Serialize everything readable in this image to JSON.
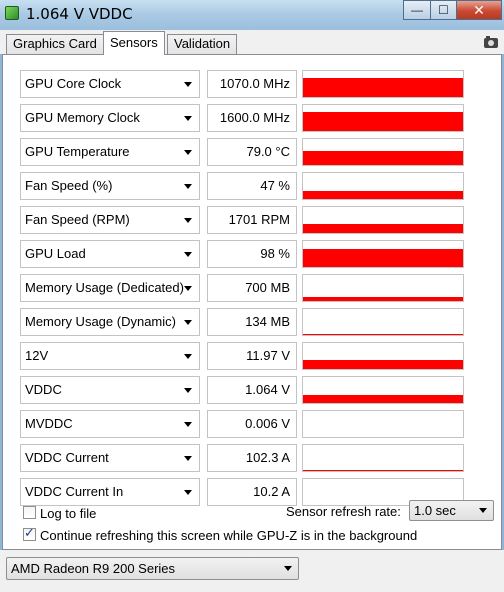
{
  "window": {
    "title": "1.064 V VDDC",
    "minimize_glyph": "—",
    "maximize_glyph": "☐",
    "close_glyph": "✕"
  },
  "tabs": [
    {
      "label": "Graphics Card"
    },
    {
      "label": "Sensors"
    },
    {
      "label": "Validation"
    }
  ],
  "sensors": [
    {
      "label": "GPU Core Clock",
      "value": "1070.0 MHz",
      "graph_level": 0.75
    },
    {
      "label": "GPU Memory Clock",
      "value": "1600.0 MHz",
      "graph_level": 0.75
    },
    {
      "label": "GPU Temperature",
      "value": "79.0 °C",
      "graph_level": 0.55
    },
    {
      "label": "Fan Speed (%)",
      "value": "47 %",
      "graph_level": 0.3
    },
    {
      "label": "Fan Speed (RPM)",
      "value": "1701 RPM",
      "graph_level": 0.35
    },
    {
      "label": "GPU Load",
      "value": "98 %",
      "graph_level": 0.7
    },
    {
      "label": "Memory Usage (Dedicated)",
      "value": "700 MB",
      "graph_level": 0.15
    },
    {
      "label": "Memory Usage (Dynamic)",
      "value": "134 MB",
      "graph_level": 0.04
    },
    {
      "label": "12V",
      "value": "11.97 V",
      "graph_level": 0.35
    },
    {
      "label": "VDDC",
      "value": "1.064 V",
      "graph_level": 0.3
    },
    {
      "label": "MVDDC",
      "value": "0.006 V",
      "graph_level": 0.0
    },
    {
      "label": "VDDC Current",
      "value": "102.3 A",
      "graph_level": 0.02
    },
    {
      "label": "VDDC Current In",
      "value": "10.2 A",
      "graph_level": 0.0
    }
  ],
  "options": {
    "log_to_file": {
      "label": "Log to file",
      "checked": false
    },
    "continue_refreshing": {
      "label": "Continue refreshing this screen while GPU-Z is in the background",
      "checked": true
    },
    "refresh_rate": {
      "label": "Sensor refresh rate:",
      "value": "1.0 sec"
    }
  },
  "gpu_select": {
    "value": "AMD Radeon R9 200 Series"
  },
  "colors": {
    "graph": "#ff0000"
  }
}
